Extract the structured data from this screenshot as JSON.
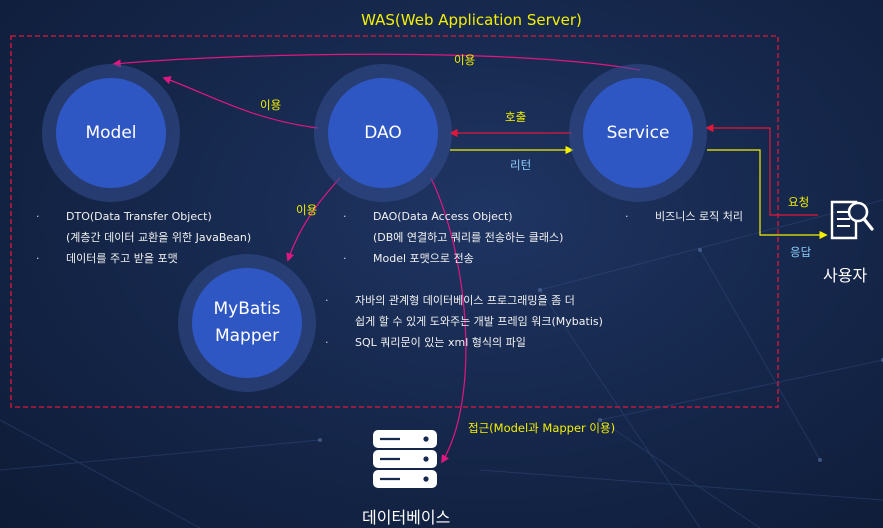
{
  "title": "WAS(Web Application Server)",
  "nodes": {
    "model": "Model",
    "dao": "DAO",
    "service": "Service",
    "mybatis_line1": "MyBatis",
    "mybatis_line2": "Mapper"
  },
  "edges": {
    "service_model": "이용",
    "dao_model": "이용",
    "service_dao_call": "호출",
    "dao_service_return": "리턴",
    "dao_mybatis": "이용",
    "request": "요청",
    "response": "응답",
    "access": "접근(Model과 Mapper 이용)"
  },
  "descriptions": {
    "model": [
      "DTO(Data Transfer Object)",
      "(계층간 데이터 교환을 위한 JavaBean)",
      "데이터를 주고 받을 포맷"
    ],
    "dao": [
      "DAO(Data Access Object)",
      "(DB에 연결하고 쿼리를 전송하는 클래스)",
      "Model 포맷으로 전송"
    ],
    "service": [
      "비즈니스 로직 처리"
    ],
    "mybatis": [
      "자바의 관계형 데이터베이스 프로그래밍을 좀 더",
      "쉽게 할 수 있게 도와주는 개발 프레임 워크(Mybatis)",
      "SQL 쿼리문이 있는 xml 형식의 파일"
    ]
  },
  "user_label": "사용자",
  "database_label": "데이터베이스",
  "icons": {
    "user": "document-search-icon",
    "database": "database-icon"
  },
  "colors": {
    "title": "#f4f000",
    "uses": "#e0177f",
    "call": "#f4f000",
    "border": "#e0173a",
    "node": "#2f57c4"
  }
}
